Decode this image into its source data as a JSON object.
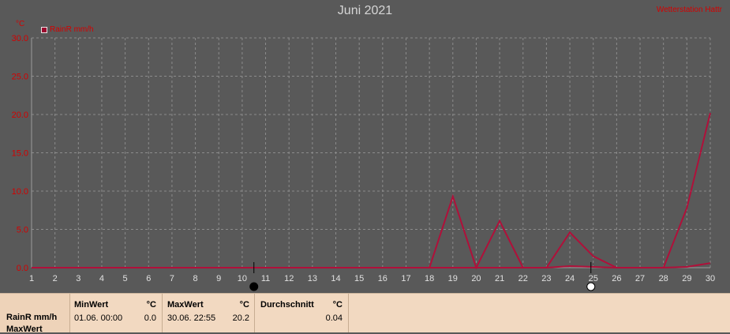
{
  "chart_data": {
    "type": "line",
    "title": "Juni 2021",
    "credit": "Wetterstation Hattr",
    "unit": "°C",
    "legend": [
      {
        "name": "RainR mm/h",
        "color": "#9a0a2e"
      }
    ],
    "x": [
      1,
      2,
      3,
      4,
      5,
      6,
      7,
      8,
      9,
      10,
      11,
      12,
      13,
      14,
      15,
      16,
      17,
      18,
      19,
      20,
      21,
      22,
      23,
      24,
      25,
      26,
      27,
      28,
      29,
      30
    ],
    "xlim": [
      1,
      30
    ],
    "ylim": [
      0,
      30
    ],
    "ytick_labels": [
      "0.0",
      "5.0",
      "10.0",
      "15.0",
      "20.0",
      "25.0",
      "30.0"
    ],
    "xtick_labels": [
      "1",
      "2",
      "3",
      "4",
      "5",
      "6",
      "7",
      "8",
      "9",
      "10",
      "11",
      "12",
      "13",
      "14",
      "15",
      "16",
      "17",
      "18",
      "19",
      "20",
      "21",
      "22",
      "23",
      "24",
      "25",
      "26",
      "27",
      "28",
      "29",
      "30"
    ],
    "grid": true,
    "series": [
      {
        "name": "RainR mm/h",
        "color": "#b0103a",
        "points": [
          [
            1,
            0
          ],
          [
            18,
            0
          ],
          [
            19,
            9.3
          ],
          [
            20,
            0
          ],
          [
            21,
            6.1
          ],
          [
            22,
            0
          ],
          [
            23,
            0
          ],
          [
            24,
            4.6
          ],
          [
            25,
            1.5
          ],
          [
            26,
            0
          ],
          [
            28,
            0
          ],
          [
            29,
            7.8
          ],
          [
            30,
            20.2
          ]
        ]
      },
      {
        "name": "RainR mm/h",
        "color": "#b0103a",
        "points": [
          [
            1,
            0
          ],
          [
            23,
            0
          ],
          [
            24,
            0.2
          ],
          [
            25,
            0.1
          ],
          [
            26,
            0
          ],
          [
            28,
            0
          ],
          [
            29,
            0.1
          ],
          [
            30,
            0.6
          ]
        ]
      }
    ],
    "markers": [
      {
        "x": 10.5,
        "label": "moon-full-black"
      },
      {
        "x": 24.9,
        "label": "moon-full-white"
      }
    ]
  },
  "stats": {
    "series_label": "RainR mm/h",
    "row2_label": "MaxWert",
    "min_header": "MinWert",
    "min_unit": "°C",
    "min_date": "01.06.  00:00",
    "min_value": "0.0",
    "max_header": "MaxWert",
    "max_unit": "°C",
    "max_date": "30.06.  22:55",
    "max_value": "20.2",
    "avg_header": "Durchschnitt",
    "avg_unit": "°C",
    "avg_value": "0.04"
  }
}
